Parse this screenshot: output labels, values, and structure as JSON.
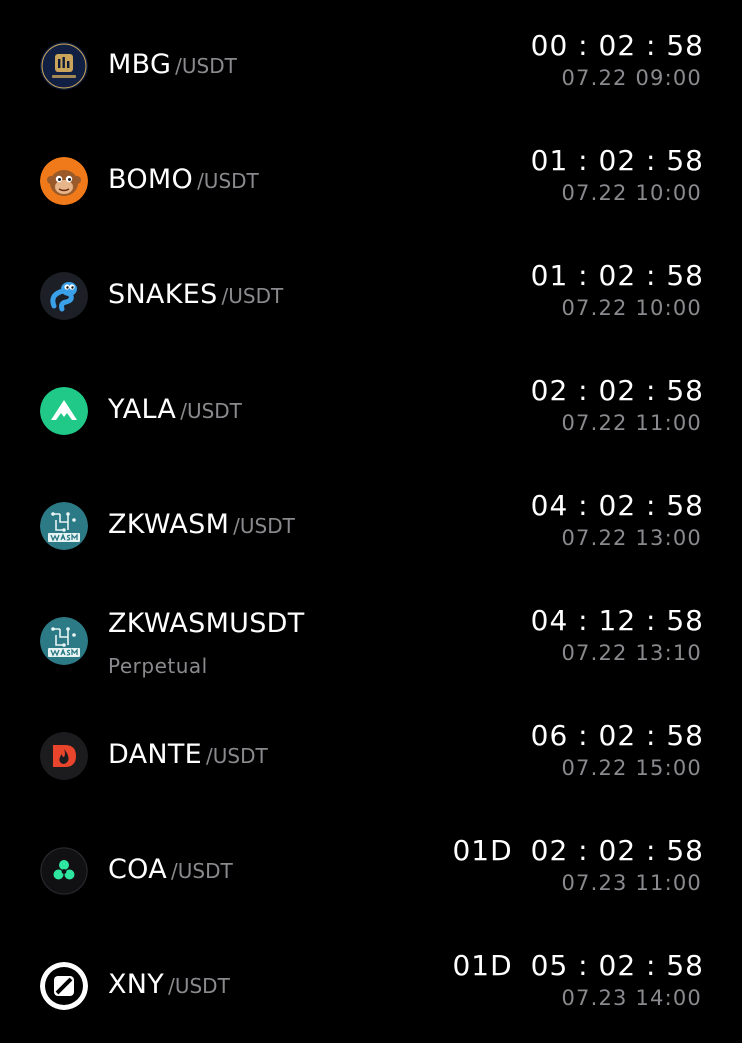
{
  "items": [
    {
      "symbol": "MBG",
      "quote": "/USDT",
      "sub": "",
      "days": "",
      "countdown": "00 : 02 : 58",
      "date": "07.22 09:00",
      "icon": "mbg-token-icon"
    },
    {
      "symbol": "BOMO",
      "quote": "/USDT",
      "sub": "",
      "days": "",
      "countdown": "01 : 02 : 58",
      "date": "07.22 10:00",
      "icon": "bomo-monkey-icon"
    },
    {
      "symbol": "SNAKES",
      "quote": "/USDT",
      "sub": "",
      "days": "",
      "countdown": "01 : 02 : 58",
      "date": "07.22 10:00",
      "icon": "snakes-icon"
    },
    {
      "symbol": "YALA",
      "quote": "/USDT",
      "sub": "",
      "days": "",
      "countdown": "02 : 02 : 58",
      "date": "07.22 11:00",
      "icon": "yala-mountain-icon"
    },
    {
      "symbol": "ZKWASM",
      "quote": "/USDT",
      "sub": "",
      "days": "",
      "countdown": "04 : 02 : 58",
      "date": "07.22 13:00",
      "icon": "zkwasm-icon"
    },
    {
      "symbol": "ZKWASMUSDT",
      "quote": "",
      "sub": "Perpetual",
      "days": "",
      "countdown": "04 : 12 : 58",
      "date": "07.22 13:10",
      "icon": "zkwasm-icon"
    },
    {
      "symbol": "DANTE",
      "quote": "/USDT",
      "sub": "",
      "days": "",
      "countdown": "06 : 02 : 58",
      "date": "07.22 15:00",
      "icon": "dante-flame-icon"
    },
    {
      "symbol": "COA",
      "quote": "/USDT",
      "sub": "",
      "days": "01D",
      "countdown": "02 : 02 : 58",
      "date": "07.23 11:00",
      "icon": "coa-icon"
    },
    {
      "symbol": "XNY",
      "quote": "/USDT",
      "sub": "",
      "days": "01D",
      "countdown": "05 : 02 : 58",
      "date": "07.23 14:00",
      "icon": "xny-icon"
    }
  ],
  "colors": {
    "background": "#000000",
    "primary_text": "#ffffff",
    "secondary_text": "#8a8a8e",
    "bomo_orange": "#f07a1a",
    "yala_green": "#20c987",
    "zkwasm_teal": "#2c7a86",
    "dante_red": "#e8452c",
    "coa_green": "#2ee6a0"
  }
}
